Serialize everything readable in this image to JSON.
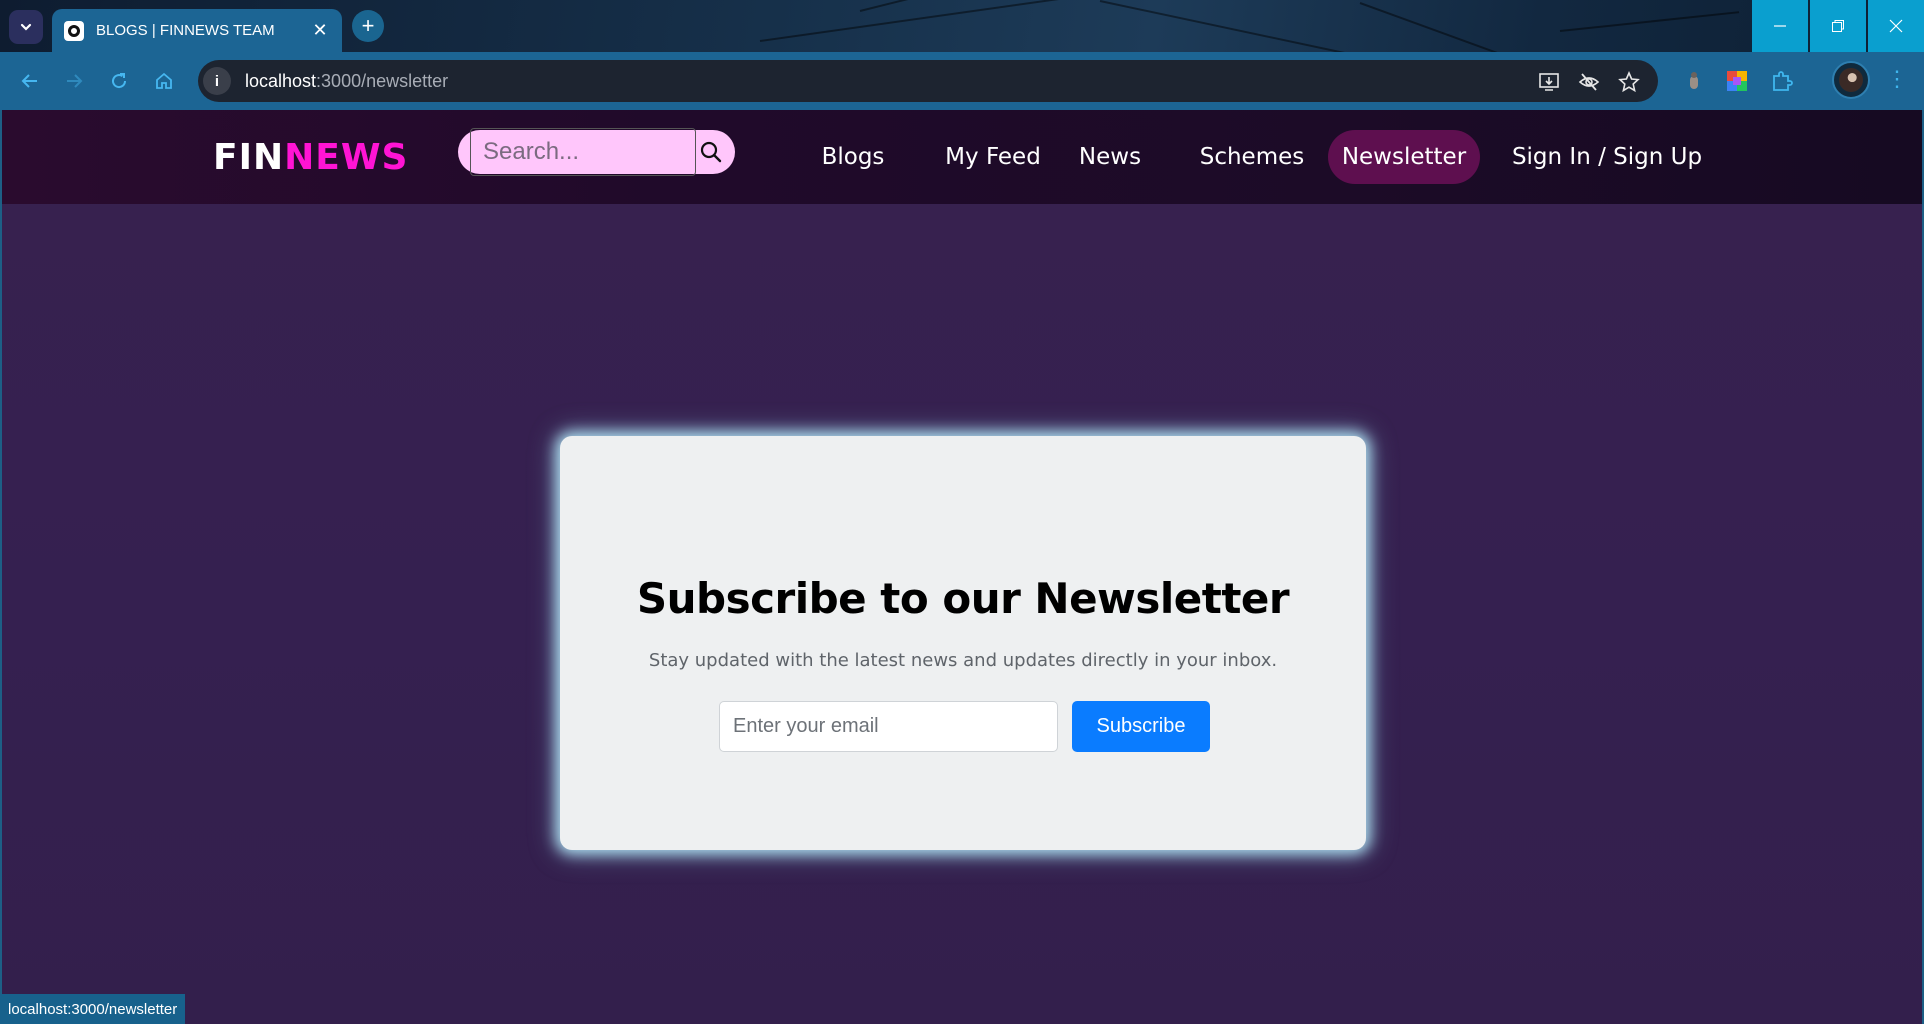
{
  "browser": {
    "tab_title": "BLOGS | FINNEWS TEAM",
    "url_host": "localhost",
    "url_path": ":3000/newsletter",
    "status_url": "localhost:3000/newsletter"
  },
  "site": {
    "logo_fin": "FIN",
    "logo_news": "NEWS",
    "search_placeholder": "Search...",
    "nav": [
      {
        "label": "Blogs"
      },
      {
        "label": "My Feed"
      },
      {
        "label": "News"
      },
      {
        "label": "Schemes"
      },
      {
        "label": "Newsletter",
        "active": true
      },
      {
        "label": "Sign In / Sign Up"
      }
    ]
  },
  "newsletter": {
    "heading": "Subscribe to our Newsletter",
    "subtext": "Stay updated with the latest news and updates directly in your inbox.",
    "email_placeholder": "Enter your email",
    "subscribe_label": "Subscribe"
  },
  "colors": {
    "accent_pink": "#ff14d4",
    "nav_active_bg": "#5e0f4f",
    "button_blue": "#0a7cff",
    "page_bg": "#362150"
  },
  "icons": [
    "chevron-down-icon",
    "tab-favicon",
    "close-icon",
    "plus-icon",
    "minimize-icon",
    "restore-icon",
    "window-close-icon",
    "back-icon",
    "forward-icon",
    "reload-icon",
    "home-icon",
    "site-info-icon",
    "install-app-icon",
    "eye-off-icon",
    "star-icon",
    "extension-icon",
    "puzzle-icon",
    "avatar",
    "more-icon",
    "search-icon"
  ]
}
